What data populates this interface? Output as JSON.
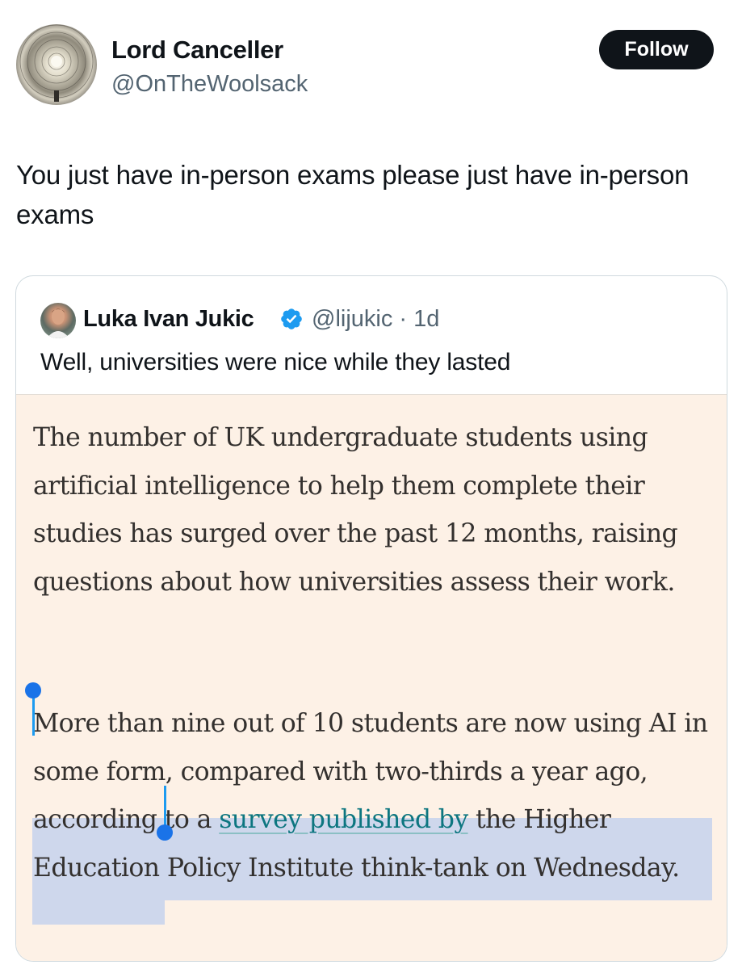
{
  "author": {
    "name": "Lord Canceller",
    "handle": "@OnTheWoolsack",
    "follow_label": "Follow"
  },
  "tweet": {
    "text": "You just have in-person exams please just have in-person exams"
  },
  "quoted": {
    "name": "Luka Ivan Jukic",
    "handle_time": "@lijukic · 1d",
    "verified": true,
    "text": "Well, universities were nice while they lasted",
    "article": {
      "paragraph1": "The number of UK undergraduate students using artificial intelligence to help them complete their studies has surged over the past 12 months, raising questions about how universities assess their work.",
      "paragraph2_before_link": "More than nine out of 10 students are now using AI in some form, compared with two-thirds a year ago, according to a ",
      "paragraph2_link": "survey published by",
      "paragraph2_after_link": " the Higher Education Policy Institute think-tank on Wednesday."
    }
  },
  "colors": {
    "follow_bg": "#0f1419",
    "verified": "#1d9bf0",
    "article_bg": "#fdf1e6",
    "selection": "#c9d4ec",
    "link": "#0d7680"
  }
}
